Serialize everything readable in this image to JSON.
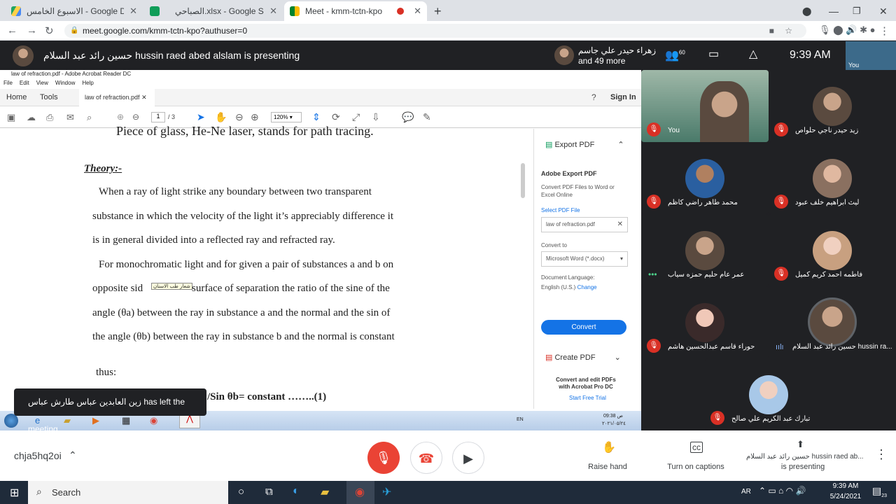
{
  "browser": {
    "tabs": [
      {
        "title": "الاسبوع الخامس - Google Drive",
        "active": false
      },
      {
        "title": "الصباحي.xlsx - Google Sheets",
        "active": false
      },
      {
        "title": "Meet - kmm-tctn-kpo",
        "active": true
      }
    ],
    "url": "meet.google.com/kmm-tctn-kpo?authuser=0"
  },
  "meet": {
    "presenter_text": "حسين رائد عبد السلام hussin raed abed alslam is presenting",
    "others_name": "زهراء حيدر علي جاسم",
    "others_more": "and 49 more",
    "people_count": "60",
    "time": "9:39  AM",
    "self_label": "You"
  },
  "acrobat": {
    "title": "law of refraction.pdf - Adobe Acrobat Reader DC",
    "menu": [
      "File",
      "Edit",
      "View",
      "Window",
      "Help"
    ],
    "home": "Home",
    "tools": "Tools",
    "doc_tab": "law of refraction.pdf",
    "sign_in": "Sign In",
    "page_num": "1",
    "page_total": "/ 3",
    "zoom": "120%",
    "doc": {
      "heading_cut": "Piece of glass, He-Ne laser, stands for path tracing.",
      "theory": "Theory:-",
      "lines": [
        "When a ray of light strike any boundary between two transparent",
        "substance in which the velocity of the light it’s appreciably difference it",
        "is in general divided into a reflected ray and refracted ray.",
        "For monochromatic light and for given a pair of substances a and b on",
        "opposite sid",
        "surface of separation the ratio of the sine of the",
        "angle (θa) between the ray in substance a and the normal and the sin of",
        "the angle (θb) between the ray in substance b and the normal is constant"
      ],
      "tooltip": "شعار طب الاسنان",
      "thus": "thus:",
      "equation": "/Sin θb= constant   ……..(1)"
    },
    "panel": {
      "export_header": "Export PDF",
      "adobe_export": "Adobe Export PDF",
      "convert_desc": "Convert PDF Files to Word or Excel Online",
      "select_pdf": "Select PDF File",
      "file": "law of refraction.pdf",
      "convert_to": "Convert to",
      "format": "Microsoft Word (*.docx)",
      "doc_lang": "Document Language:",
      "lang": "English (U.S.)",
      "change": "Change",
      "convert_btn": "Convert",
      "create_pdf": "Create PDF",
      "promo": "Convert and edit PDFs with Acrobat Pro DC",
      "trial": "Start Free Trial"
    },
    "win7_clock": {
      "lang": "EN",
      "time": "09:38 ص",
      "date": "٢٠٢١/٠٥/٢٤"
    }
  },
  "toast": "زين العابدين عباس طارش عباس has left the meeting",
  "participants": [
    {
      "name": "You",
      "bg": "#4a7a6a"
    },
    {
      "name": "زيد حيدر ناجي حلواص"
    },
    {
      "name": "محمد طاهر راضي كاظم"
    },
    {
      "name": "ليث ابراهيم خلف عبود"
    },
    {
      "name": "عمر عام حليم حمزه سياب"
    },
    {
      "name": "فاطمه احمد كريم كميل"
    },
    {
      "name": "حوراء قاسم عبدالحسين هاشم"
    },
    {
      "name": "حسين رائد عبد السلام hussin ra..."
    },
    {
      "name": "تبارك عبد الكريم علي صالح"
    }
  ],
  "controls": {
    "meeting_code": "chja5hq2oi",
    "raise_hand": "Raise hand",
    "captions": "Turn on captions",
    "presenting_line1": "حسين رائد عبد السلام hussin raed ab...",
    "presenting_line2": "is presenting"
  },
  "taskbar": {
    "search": "Search",
    "lang": "AR",
    "time": "9:39 AM",
    "date": "5/24/2021",
    "notif": "23"
  }
}
